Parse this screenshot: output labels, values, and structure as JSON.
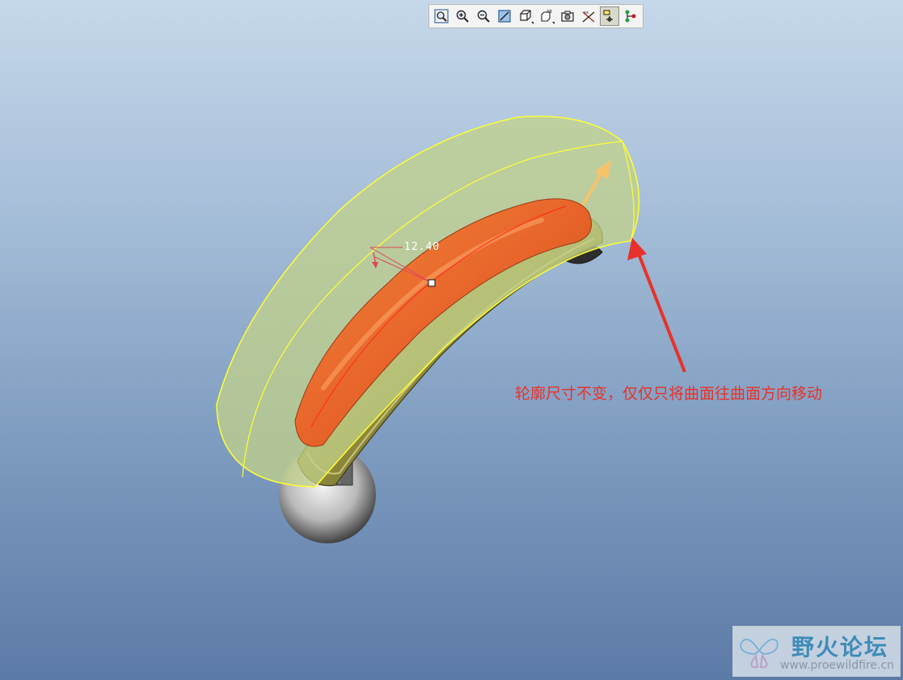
{
  "toolbar": {
    "buttons": [
      {
        "icon": "refit-icon"
      },
      {
        "icon": "zoom-in-icon"
      },
      {
        "icon": "zoom-out-icon"
      },
      {
        "icon": "repaint-icon"
      },
      {
        "icon": "display-style-icon"
      },
      {
        "icon": "saved-views-icon"
      },
      {
        "icon": "orient-mode-icon"
      },
      {
        "icon": "datum-display-icon"
      },
      {
        "icon": "spin-center-icon",
        "active": true
      },
      {
        "icon": "model-tree-connector-icon"
      }
    ]
  },
  "model": {
    "dimension_value": "12.40",
    "colors": {
      "outer_surface": "#c2d28a",
      "inner_surface": "#e8642a",
      "edge_highlight": "#ffff33",
      "drag_arrow": "#f7c36a"
    }
  },
  "annotation": {
    "text": "轮廓尺寸不变，仅仅只将曲面往曲面方向移动",
    "color": "#e8312a"
  },
  "watermark": {
    "title": "野火论坛",
    "url": "www.proewildfire.cn"
  }
}
